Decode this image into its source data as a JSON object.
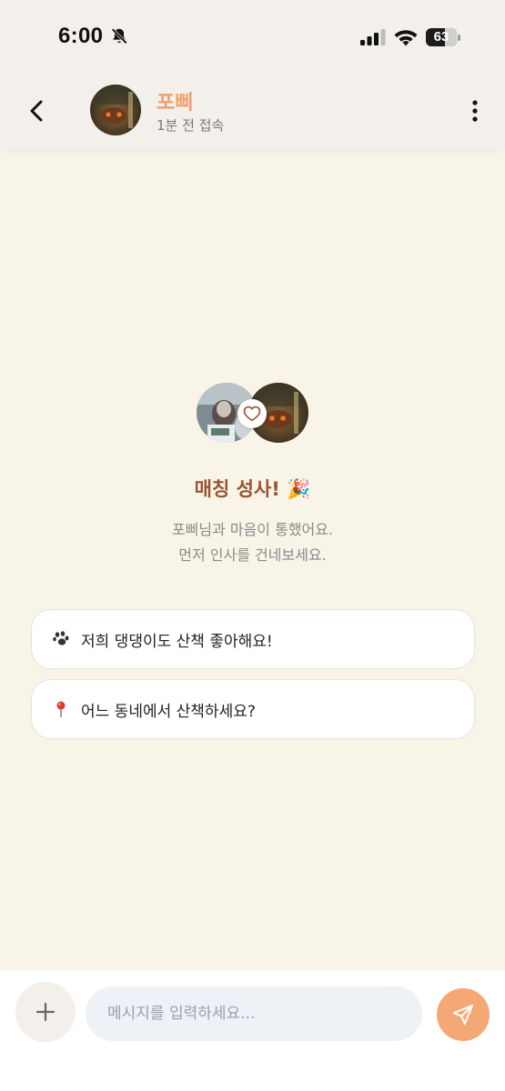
{
  "status_bar": {
    "time": "6:00",
    "battery_percent": "63",
    "battery_level": 0.63
  },
  "header": {
    "contact_name": "포삐",
    "contact_status": "1분 전 접속",
    "back_icon": "chevron-left-icon",
    "more_icon": "more-vertical-icon"
  },
  "match": {
    "title": "매칭 성사!",
    "title_emoji": "🎉",
    "line1": "포삐님과 마음이 통했어요.",
    "line2": "먼저 인사를 건네보세요.",
    "badge_icon": "heart-icon"
  },
  "suggestions": [
    {
      "icon": "paw-icon",
      "text": "저희 댕댕이도 산책 좋아해요!"
    },
    {
      "icon": "pin-icon",
      "text": "어느 동네에서 산책하세요?"
    }
  ],
  "input_bar": {
    "placeholder": "메시지를 입력하세요...",
    "plus_icon": "plus-icon",
    "send_icon": "send-icon"
  },
  "colors": {
    "background": "#f9f4e8",
    "accent": "#f4a874",
    "contact_name": "#f0a06a",
    "match_title": "#9b5433"
  }
}
